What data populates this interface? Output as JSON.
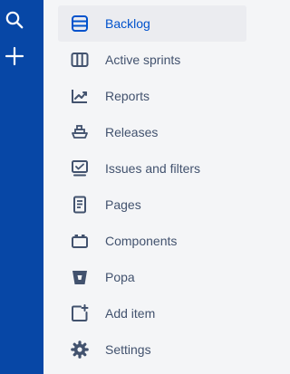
{
  "colors": {
    "rail_background": "#0747A6",
    "sidebar_background": "#F4F5F7",
    "active_item_background": "#EBECF0",
    "active_text": "#0052CC",
    "default_text": "#42526E"
  },
  "global_nav": {
    "search_icon": "search-icon",
    "create_icon": "plus-icon"
  },
  "sidebar": {
    "items": [
      {
        "label": "Backlog",
        "icon": "backlog-icon",
        "active": true
      },
      {
        "label": "Active sprints",
        "icon": "board-columns-icon",
        "active": false
      },
      {
        "label": "Reports",
        "icon": "chart-line-icon",
        "active": false
      },
      {
        "label": "Releases",
        "icon": "ship-icon",
        "active": false
      },
      {
        "label": "Issues and filters",
        "icon": "screen-icon",
        "active": false
      },
      {
        "label": "Pages",
        "icon": "page-icon",
        "active": false
      },
      {
        "label": "Components",
        "icon": "component-icon",
        "active": false
      },
      {
        "label": "Popa",
        "icon": "bitbucket-icon",
        "active": false
      },
      {
        "label": "Add item",
        "icon": "add-item-icon",
        "active": false
      },
      {
        "label": "Settings",
        "icon": "gear-icon",
        "active": false
      }
    ]
  }
}
